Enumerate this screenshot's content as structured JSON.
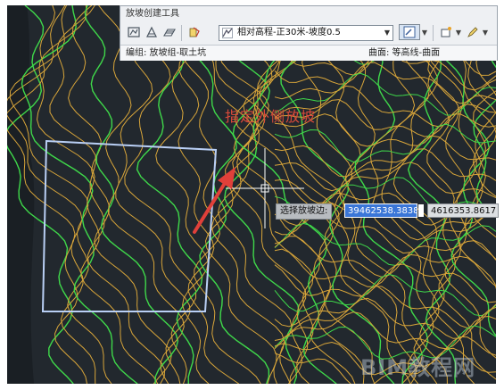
{
  "toolbar": {
    "title": "放坡创建工具",
    "style_select": {
      "selected": "相对高程-正30米-坡度0.5",
      "icon": "grading-style-icon"
    },
    "status_left": "编组: 放坡组-取土坑",
    "status_right": "曲面: 等高线-曲面",
    "buttons": [
      "grading-settings-icon",
      "create-grading-icon",
      "create-group-icon",
      "style-picker-icon",
      "edit-criteria-icon",
      "insert-point-icon",
      "edit-elevation-icon"
    ]
  },
  "canvas": {
    "hint": "指定外侧放坡",
    "prompt_label": "选择放坡边:",
    "coord_x": "39462538.3838",
    "coord_y": "4616353.8617",
    "watermark": "BIM教程网",
    "colors": {
      "background": "#22282e",
      "contour_major": "#3fd94a",
      "contour_minor": "#d9a63a",
      "selection": "#b9cff5",
      "arrow": "#e0403a"
    }
  }
}
